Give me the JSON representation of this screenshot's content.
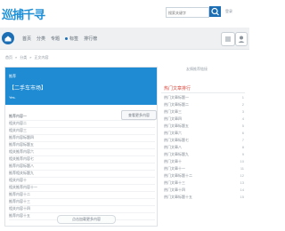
{
  "header": {
    "logo": "巡捕千寻",
    "search_placeholder": "搜索关键字",
    "right_text": "登录"
  },
  "nav": {
    "items": [
      "首页",
      "分类",
      "专题",
      "标签",
      "排行榜"
    ]
  },
  "breadcrumb": [
    "首页",
    "»",
    "分类",
    "»",
    "正文内容"
  ],
  "main": {
    "banner": {
      "line1": "推荐",
      "line2": "【二手车市场】",
      "line3": "Yes."
    },
    "action_button": "查看更多内容",
    "list": [
      "推荐内容一",
      "相关内容二",
      "相关内容三",
      "推荐内容标题四",
      "推荐内容标题五",
      "相关推荐内容六",
      "相关推荐内容七",
      "推荐内容标题八",
      "推荐相关标题九",
      "相关内容十",
      "相关推荐内容十一",
      "推荐内容十二",
      "推荐内容十三",
      "相关内容十四",
      "推荐内容十五"
    ],
    "load_more": "点击加载更多内容"
  },
  "sidebar": {
    "top_text": "友情推荐链接",
    "heading": "热门文章排行",
    "items": [
      {
        "text": "热门文章标题一",
        "num": "1"
      },
      {
        "text": "热门文章标题二",
        "num": "2"
      },
      {
        "text": "热门文章三",
        "num": "3"
      },
      {
        "text": "热门文章四",
        "num": "4"
      },
      {
        "text": "热门文章标题五",
        "num": "5"
      },
      {
        "text": "热门文章六",
        "num": "6"
      },
      {
        "text": "热门文章标题七",
        "num": "7"
      },
      {
        "text": "热门文章八",
        "num": "8"
      },
      {
        "text": "热门文章标题九",
        "num": "9"
      },
      {
        "text": "热门文章十",
        "num": "10"
      },
      {
        "text": "热门文章十一",
        "num": "11"
      },
      {
        "text": "热门文章标题十二",
        "num": "12"
      },
      {
        "text": "热门文章十三",
        "num": "13"
      },
      {
        "text": "热门文章十四",
        "num": "14"
      },
      {
        "text": "热门文章标题十五",
        "num": "15"
      }
    ]
  },
  "colors": {
    "accent": "#1c6fb5",
    "banner": "#1f8bd2",
    "sidebar_heading": "#d7473c"
  },
  "icons": {
    "search": "search-icon",
    "home": "home-icon",
    "menu": "menu-icon",
    "user": "user-icon"
  }
}
